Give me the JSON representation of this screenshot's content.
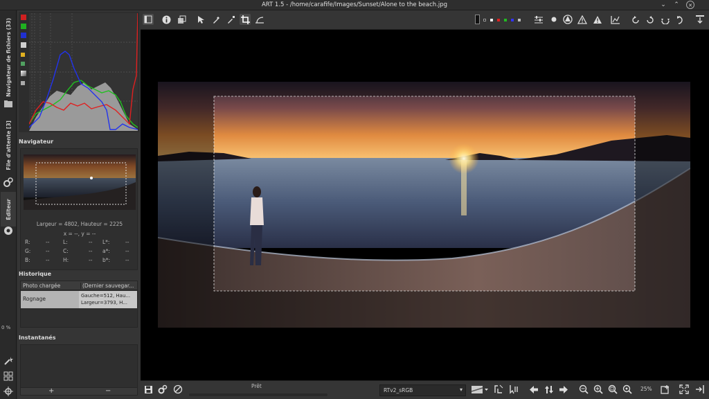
{
  "window": {
    "title": "ART 1.5 - /home/carafife/Images/Sunset/Alone to the beach.jpg",
    "minimize_glyph": "⌄",
    "maximize_glyph": "⌃",
    "close_glyph": "✕"
  },
  "side_tabs": {
    "file_browser": "Navigateur de fichiers (33)",
    "queue": "File d'attente [3]",
    "editor": "Éditeur",
    "percent": "0 %"
  },
  "navigator": {
    "title": "Navigateur",
    "dimensions": "Largeur = 4802, Hauteur = 2225",
    "coords": "x = --, y = --",
    "rows": [
      [
        {
          "label": "R:",
          "value": "--"
        },
        {
          "label": "L:",
          "value": "--"
        },
        {
          "label": "L*:",
          "value": "--"
        }
      ],
      [
        {
          "label": "G:",
          "value": "--"
        },
        {
          "label": "C:",
          "value": "--"
        },
        {
          "label": "a*:",
          "value": "--"
        }
      ],
      [
        {
          "label": "B:",
          "value": "--"
        },
        {
          "label": "H:",
          "value": "--"
        },
        {
          "label": "b*:",
          "value": "--"
        }
      ]
    ]
  },
  "history": {
    "title": "Historique",
    "col1": "Photo chargée",
    "col2": "(Dernier sauvegar...",
    "row_label": "Rognage",
    "row_detail1": "Gauche=512, Hau...",
    "row_detail2": "Largeur=3793, H..."
  },
  "snapshots": {
    "title": "Instantanés",
    "add": "+",
    "remove": "−"
  },
  "status": {
    "text": "Prêt",
    "progress": 0
  },
  "output_profile": "RTv2_sRGB",
  "zoom": "25%",
  "colors": {
    "accent": "#c9c9c9",
    "panel": "#353535",
    "viewer_bg": "#000000",
    "history_selected": "#b4b4b4"
  }
}
